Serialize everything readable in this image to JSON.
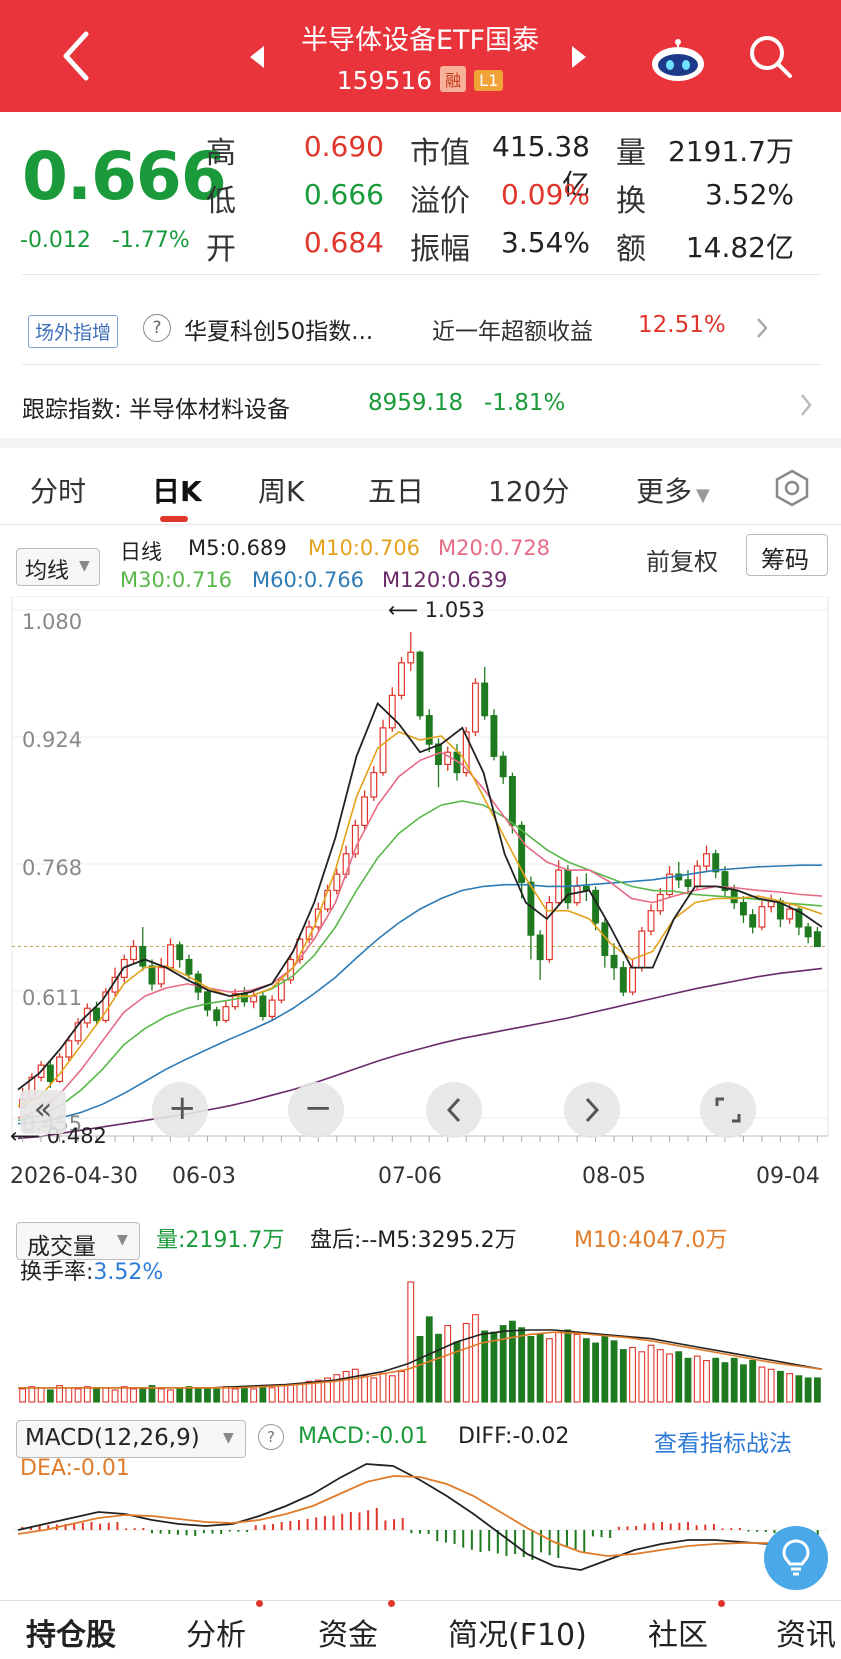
{
  "header": {
    "title": "半导体设备ETF国泰",
    "code": "159516",
    "tag_rong": "融",
    "tag_level": "L1"
  },
  "quote": {
    "price": "0.666",
    "change": "-0.012",
    "change_pct": "-1.77%",
    "rows": [
      {
        "l1": "高",
        "v1": "0.690",
        "c1": "red",
        "l2": "市值",
        "v2": "415.38亿",
        "c2": "dark",
        "l3": "量",
        "v3": "2191.7万"
      },
      {
        "l1": "低",
        "v1": "0.666",
        "c1": "green",
        "l2": "溢价",
        "v2": "0.09%",
        "c2": "red",
        "l3": "换",
        "v3": "3.52%"
      },
      {
        "l1": "开",
        "v1": "0.684",
        "c1": "red",
        "l2": "振幅",
        "v2": "3.54%",
        "c2": "dark",
        "l3": "额",
        "v3": "14.82亿"
      }
    ]
  },
  "offmarket": {
    "tag": "场外指增",
    "fund": "华夏科创50指数...",
    "label": "近一年超额收益",
    "value": "12.51%"
  },
  "tracking": {
    "label": "跟踪指数: 半导体材料设备",
    "value": "8959.18",
    "change": "-1.81%"
  },
  "tabs": [
    "分时",
    "日K",
    "周K",
    "五日",
    "120分",
    "更多"
  ],
  "kline_header": {
    "ma_select": "均线",
    "period": "日线",
    "m5": "M5:0.689",
    "m10": "M10:0.706",
    "m20": "M20:0.728",
    "m30": "M30:0.716",
    "m60": "M60:0.766",
    "m120": "M120:0.639",
    "adjust": "前复权",
    "chip_btn": "筹码",
    "colors": {
      "m5": "#222222",
      "m10": "#e3a21a",
      "m20": "#e76b86",
      "m30": "#59b84a",
      "m60": "#2d7bb6",
      "m120": "#6b2a6a"
    }
  },
  "chart_data": [
    {
      "type": "candlestick",
      "title": "",
      "y_ticks": [
        "1.080",
        "0.924",
        "0.768",
        "0.611",
        "0.455"
      ],
      "ylim": [
        0.455,
        1.08
      ],
      "x_ticks": [
        "2026-04-30",
        "06-03",
        "07-06",
        "08-05",
        "09-04"
      ],
      "high_marker": "1.053",
      "low_marker": "0.482",
      "last_close": 0.666,
      "candles": [
        [
          0.468,
          0.478,
          0.492,
          0.482
        ],
        [
          0.478,
          0.505,
          0.51,
          0.476
        ],
        [
          0.505,
          0.52,
          0.525,
          0.5
        ],
        [
          0.52,
          0.5,
          0.525,
          0.492
        ],
        [
          0.5,
          0.53,
          0.535,
          0.498
        ],
        [
          0.53,
          0.55,
          0.556,
          0.525
        ],
        [
          0.55,
          0.572,
          0.578,
          0.545
        ],
        [
          0.572,
          0.59,
          0.596,
          0.566
        ],
        [
          0.59,
          0.575,
          0.598,
          0.57
        ],
        [
          0.575,
          0.61,
          0.615,
          0.572
        ],
        [
          0.61,
          0.628,
          0.64,
          0.605
        ],
        [
          0.628,
          0.65,
          0.656,
          0.622
        ],
        [
          0.65,
          0.666,
          0.674,
          0.644
        ],
        [
          0.666,
          0.642,
          0.69,
          0.636
        ],
        [
          0.642,
          0.62,
          0.65,
          0.612
        ],
        [
          0.62,
          0.64,
          0.652,
          0.615
        ],
        [
          0.64,
          0.668,
          0.676,
          0.636
        ],
        [
          0.668,
          0.65,
          0.672,
          0.64
        ],
        [
          0.65,
          0.632,
          0.656,
          0.626
        ],
        [
          0.632,
          0.61,
          0.636,
          0.6
        ],
        [
          0.61,
          0.588,
          0.614,
          0.58
        ],
        [
          0.588,
          0.575,
          0.592,
          0.568
        ],
        [
          0.575,
          0.592,
          0.6,
          0.572
        ],
        [
          0.592,
          0.608,
          0.614,
          0.588
        ],
        [
          0.608,
          0.598,
          0.616,
          0.592
        ],
        [
          0.598,
          0.605,
          0.612,
          0.59
        ],
        [
          0.605,
          0.58,
          0.61,
          0.575
        ],
        [
          0.58,
          0.6,
          0.606,
          0.576
        ],
        [
          0.6,
          0.625,
          0.63,
          0.596
        ],
        [
          0.625,
          0.65,
          0.656,
          0.62
        ],
        [
          0.65,
          0.675,
          0.682,
          0.645
        ],
        [
          0.675,
          0.69,
          0.698,
          0.67
        ],
        [
          0.69,
          0.712,
          0.72,
          0.686
        ],
        [
          0.712,
          0.735,
          0.742,
          0.708
        ],
        [
          0.735,
          0.755,
          0.762,
          0.73
        ],
        [
          0.755,
          0.78,
          0.79,
          0.75
        ],
        [
          0.78,
          0.815,
          0.822,
          0.775
        ],
        [
          0.815,
          0.85,
          0.858,
          0.81
        ],
        [
          0.85,
          0.88,
          0.888,
          0.845
        ],
        [
          0.88,
          0.935,
          0.945,
          0.876
        ],
        [
          0.935,
          0.975,
          0.985,
          0.93
        ],
        [
          0.975,
          1.015,
          1.022,
          0.97
        ],
        [
          1.015,
          1.028,
          1.053,
          1.005
        ],
        [
          1.028,
          0.95,
          1.03,
          0.945
        ],
        [
          0.95,
          0.915,
          0.958,
          0.905
        ],
        [
          0.915,
          0.89,
          0.922,
          0.862
        ],
        [
          0.89,
          0.905,
          0.912,
          0.882
        ],
        [
          0.905,
          0.88,
          0.915,
          0.87
        ],
        [
          0.88,
          0.93,
          0.936,
          0.875
        ],
        [
          0.93,
          0.99,
          0.996,
          0.925
        ],
        [
          0.99,
          0.95,
          1.01,
          0.945
        ],
        [
          0.95,
          0.9,
          0.958,
          0.895
        ],
        [
          0.9,
          0.875,
          0.906,
          0.866
        ],
        [
          0.875,
          0.815,
          0.88,
          0.805
        ],
        [
          0.815,
          0.745,
          0.82,
          0.725
        ],
        [
          0.745,
          0.68,
          0.752,
          0.65
        ],
        [
          0.68,
          0.65,
          0.686,
          0.625
        ],
        [
          0.65,
          0.72,
          0.728,
          0.646
        ],
        [
          0.72,
          0.76,
          0.772,
          0.716
        ],
        [
          0.76,
          0.72,
          0.766,
          0.712
        ],
        [
          0.72,
          0.74,
          0.752,
          0.716
        ],
        [
          0.74,
          0.735,
          0.756,
          0.722
        ],
        [
          0.735,
          0.695,
          0.74,
          0.686
        ],
        [
          0.695,
          0.655,
          0.7,
          0.64
        ],
        [
          0.655,
          0.64,
          0.67,
          0.625
        ],
        [
          0.64,
          0.61,
          0.648,
          0.605
        ],
        [
          0.61,
          0.64,
          0.65,
          0.606
        ],
        [
          0.64,
          0.685,
          0.69,
          0.635
        ],
        [
          0.685,
          0.71,
          0.718,
          0.68
        ],
        [
          0.71,
          0.73,
          0.738,
          0.705
        ],
        [
          0.73,
          0.755,
          0.765,
          0.726
        ],
        [
          0.755,
          0.748,
          0.77,
          0.738
        ],
        [
          0.748,
          0.74,
          0.76,
          0.73
        ],
        [
          0.74,
          0.765,
          0.772,
          0.736
        ],
        [
          0.765,
          0.78,
          0.79,
          0.758
        ],
        [
          0.78,
          0.758,
          0.785,
          0.75
        ],
        [
          0.758,
          0.735,
          0.765,
          0.728
        ],
        [
          0.735,
          0.72,
          0.742,
          0.712
        ],
        [
          0.72,
          0.705,
          0.728,
          0.695
        ],
        [
          0.705,
          0.69,
          0.712,
          0.682
        ],
        [
          0.69,
          0.715,
          0.722,
          0.686
        ],
        [
          0.715,
          0.722,
          0.73,
          0.708
        ],
        [
          0.722,
          0.7,
          0.726,
          0.69
        ],
        [
          0.7,
          0.712,
          0.72,
          0.694
        ],
        [
          0.712,
          0.69,
          0.716,
          0.68
        ],
        [
          0.69,
          0.678,
          0.695,
          0.67
        ],
        [
          0.684,
          0.666,
          0.69,
          0.666
        ]
      ],
      "ma_lines": {
        "m5": [
          0.49,
          0.51,
          0.54,
          0.575,
          0.6,
          0.64,
          0.65,
          0.64,
          0.625,
          0.612,
          0.605,
          0.61,
          0.62,
          0.66,
          0.72,
          0.8,
          0.9,
          0.965,
          0.94,
          0.905,
          0.915,
          0.935,
          0.88,
          0.78,
          0.72,
          0.7,
          0.73,
          0.735,
          0.69,
          0.64,
          0.64,
          0.7,
          0.74,
          0.74,
          0.735,
          0.725,
          0.72,
          0.708,
          0.69
        ],
        "m10": [
          0.47,
          0.48,
          0.51,
          0.545,
          0.58,
          0.62,
          0.64,
          0.642,
          0.63,
          0.615,
          0.605,
          0.605,
          0.615,
          0.64,
          0.69,
          0.76,
          0.85,
          0.91,
          0.93,
          0.92,
          0.925,
          0.9,
          0.85,
          0.8,
          0.75,
          0.71,
          0.71,
          0.7,
          0.67,
          0.65,
          0.66,
          0.7,
          0.72,
          0.725,
          0.725,
          0.728,
          0.722,
          0.715,
          0.706
        ],
        "m20": [
          0.455,
          0.465,
          0.485,
          0.515,
          0.55,
          0.585,
          0.605,
          0.615,
          0.62,
          0.615,
          0.61,
          0.612,
          0.62,
          0.64,
          0.675,
          0.72,
          0.79,
          0.84,
          0.875,
          0.895,
          0.905,
          0.89,
          0.86,
          0.825,
          0.79,
          0.77,
          0.76,
          0.76,
          0.745,
          0.725,
          0.72,
          0.728,
          0.735,
          0.74,
          0.738,
          0.735,
          0.733,
          0.73,
          0.728
        ],
        "m30": [
          0.452,
          0.458,
          0.47,
          0.49,
          0.515,
          0.545,
          0.565,
          0.58,
          0.59,
          0.596,
          0.6,
          0.605,
          0.614,
          0.63,
          0.655,
          0.69,
          0.735,
          0.775,
          0.805,
          0.825,
          0.84,
          0.845,
          0.84,
          0.825,
          0.805,
          0.785,
          0.77,
          0.76,
          0.75,
          0.74,
          0.735,
          0.734,
          0.73,
          0.728,
          0.726,
          0.724,
          0.72,
          0.718,
          0.716
        ],
        "m60": [
          0.448,
          0.45,
          0.455,
          0.462,
          0.472,
          0.485,
          0.5,
          0.515,
          0.528,
          0.54,
          0.552,
          0.563,
          0.575,
          0.59,
          0.608,
          0.628,
          0.652,
          0.675,
          0.695,
          0.712,
          0.725,
          0.735,
          0.74,
          0.742,
          0.742,
          0.74,
          0.74,
          0.742,
          0.744,
          0.746,
          0.748,
          0.752,
          0.756,
          0.76,
          0.762,
          0.764,
          0.765,
          0.766,
          0.766
        ],
        "m120": [
          0.43,
          0.432,
          0.436,
          0.44,
          0.444,
          0.448,
          0.452,
          0.456,
          0.46,
          0.465,
          0.47,
          0.476,
          0.483,
          0.49,
          0.498,
          0.507,
          0.516,
          0.525,
          0.533,
          0.54,
          0.547,
          0.553,
          0.558,
          0.563,
          0.568,
          0.573,
          0.578,
          0.584,
          0.59,
          0.596,
          0.602,
          0.608,
          0.614,
          0.619,
          0.624,
          0.629,
          0.633,
          0.636,
          0.639
        ]
      }
    },
    {
      "type": "bar",
      "title": "成交量",
      "volume": "量:2191.7万",
      "after_hours": "盘后:--M5:3295.2万",
      "m10": "M10:4047.0万",
      "turnover_label": "换手率:",
      "turnover": "3.52%",
      "values": [
        12,
        14,
        13,
        11,
        15,
        13,
        12,
        14,
        12,
        13,
        11,
        14,
        12,
        13,
        15,
        12,
        11,
        13,
        14,
        12,
        13,
        12,
        14,
        12,
        13,
        12,
        14,
        13,
        15,
        16,
        17,
        19,
        20,
        22,
        25,
        28,
        30,
        24,
        22,
        26,
        24,
        28,
        110,
        60,
        78,
        62,
        70,
        55,
        72,
        80,
        65,
        64,
        70,
        74,
        68,
        60,
        62,
        58,
        64,
        66,
        62,
        58,
        54,
        60,
        56,
        48,
        50,
        46,
        52,
        48,
        44,
        46,
        40,
        42,
        38,
        40,
        36,
        40,
        34,
        38,
        32,
        30,
        28,
        26,
        24,
        22,
        22
      ],
      "ma": [
        13,
        13,
        13,
        13,
        13,
        13,
        13,
        13,
        13,
        14,
        15,
        16,
        18,
        20,
        24,
        28,
        35,
        45,
        55,
        62,
        65,
        66,
        66,
        64,
        62,
        60,
        58,
        54,
        50,
        46,
        42,
        38,
        34,
        30
      ],
      "ma2": [
        13,
        13,
        13,
        13,
        13,
        13,
        13,
        13,
        13,
        13,
        14,
        15,
        17,
        19,
        22,
        26,
        30,
        38,
        46,
        54,
        58,
        62,
        64,
        63,
        61,
        59,
        56,
        52,
        48,
        44,
        40,
        36,
        33,
        30
      ]
    },
    {
      "type": "line",
      "title": "MACD(12,26,9)",
      "macd": "MACD:-0.01",
      "diff": "DIFF:-0.02",
      "dea": "DEA:-0.01",
      "link": "查看指标战法",
      "diff_line": [
        0.0,
        0.006,
        0.012,
        0.018,
        0.016,
        0.01,
        0.006,
        0.004,
        0.006,
        0.014,
        0.024,
        0.036,
        0.052,
        0.066,
        0.064,
        0.05,
        0.034,
        0.016,
        -0.004,
        -0.024,
        -0.036,
        -0.04,
        -0.03,
        -0.02,
        -0.014,
        -0.01,
        -0.01,
        -0.012,
        -0.014,
        -0.018,
        -0.02
      ],
      "dea_line": [
        -0.004,
        0.0,
        0.006,
        0.012,
        0.015,
        0.014,
        0.011,
        0.008,
        0.007,
        0.01,
        0.016,
        0.024,
        0.036,
        0.048,
        0.054,
        0.053,
        0.046,
        0.034,
        0.018,
        0.002,
        -0.012,
        -0.022,
        -0.026,
        -0.024,
        -0.02,
        -0.016,
        -0.014,
        -0.013,
        -0.013,
        -0.014,
        -0.014
      ],
      "hist": [
        0.004,
        0.006,
        0.008,
        0.008,
        0.002,
        -0.004,
        -0.006,
        -0.004,
        -0.002,
        0.006,
        0.01,
        0.014,
        0.018,
        0.022,
        0.012,
        -0.004,
        -0.014,
        -0.022,
        -0.026,
        -0.03,
        -0.028,
        -0.022,
        -0.008,
        0.004,
        0.008,
        0.008,
        0.006,
        0.002,
        -0.002,
        -0.004,
        -0.006
      ]
    }
  ],
  "chart_controls": {
    "plus": "+",
    "minus": "−"
  },
  "bottom_tabs": [
    "持仓股",
    "分析",
    "资金",
    "简况(F10)",
    "社区",
    "资讯"
  ]
}
